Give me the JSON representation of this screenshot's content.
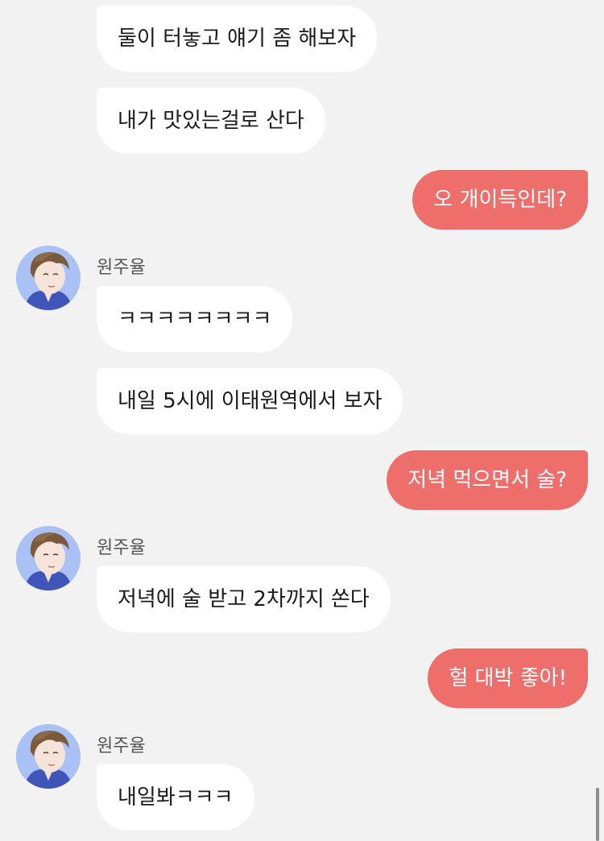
{
  "chat": {
    "sender_name": "원주율",
    "messages": [
      {
        "side": "in",
        "text": "둘이 터놓고 얘기 좀 해보자"
      },
      {
        "side": "in",
        "text": "내가 맛있는걸로 산다"
      },
      {
        "side": "out",
        "text": "오 개이득인데?"
      },
      {
        "side": "in",
        "text": "ㅋㅋㅋㅋㅋㅋㅋㅋ"
      },
      {
        "side": "in",
        "text": "내일 5시에 이태원역에서 보자"
      },
      {
        "side": "out",
        "text": "저녁 먹으면서 술?"
      },
      {
        "side": "in",
        "text": "저녁에 술 받고 2차까지 쏜다"
      },
      {
        "side": "out",
        "text": "헐 대박 좋아!"
      },
      {
        "side": "in",
        "text": "내일봐ㅋㅋㅋ"
      }
    ]
  },
  "colors": {
    "background": "#f2f2f2",
    "incoming_bubble": "#ffffff",
    "outgoing_bubble": "#ee6e6c"
  },
  "icons": {
    "avatar": "cartoon-man-avatar"
  }
}
